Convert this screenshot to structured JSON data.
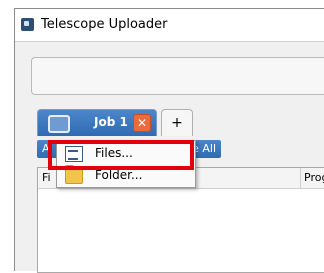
{
  "window": {
    "title": "Telescope Uploader"
  },
  "tabs": [
    {
      "label": "Job 1",
      "close_glyph": "✕",
      "icon": "folder-tab-icon"
    },
    {
      "label": "+"
    }
  ],
  "toolbar": {
    "add_label": "A",
    "remove_all_label": "e All"
  },
  "table": {
    "columns": [
      "Fi",
      "Progr"
    ]
  },
  "context_menu": {
    "items": [
      {
        "label": "Files...",
        "icon": "files-icon",
        "highlighted": true
      },
      {
        "label": "Folder...",
        "icon": "folder-icon"
      }
    ]
  },
  "colors": {
    "accent": "#2f6bb3",
    "highlight_border": "#e2000f",
    "close_button": "#ec6b3d"
  }
}
